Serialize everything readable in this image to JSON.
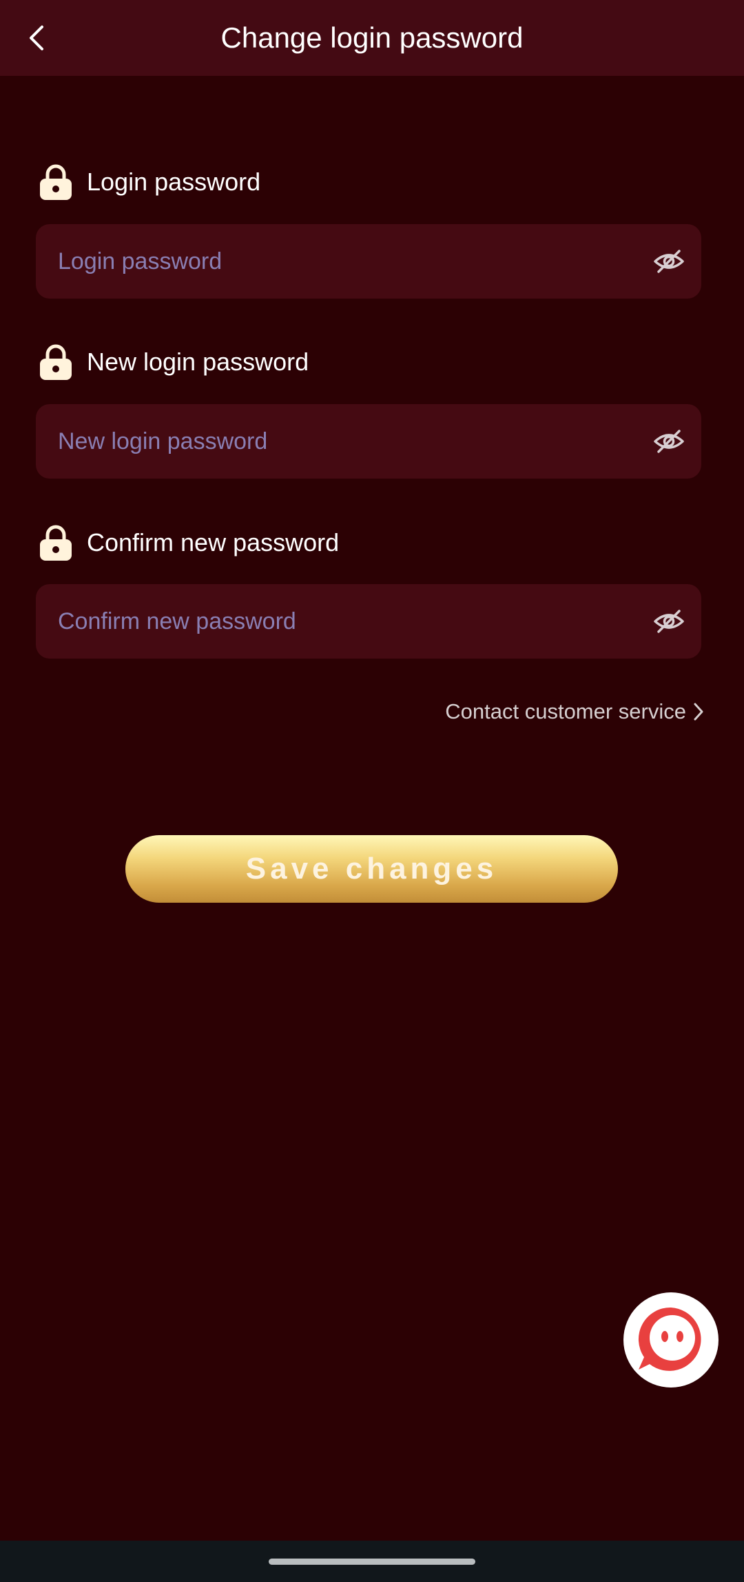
{
  "header": {
    "title": "Change login password"
  },
  "fields": [
    {
      "label": "Login password",
      "placeholder": "Login password"
    },
    {
      "label": "New login password",
      "placeholder": "New login password"
    },
    {
      "label": "Confirm new password",
      "placeholder": "Confirm new password"
    }
  ],
  "contact": {
    "label": "Contact customer service"
  },
  "save": {
    "label": "Save changes"
  },
  "icons": {
    "back": "chevron-left-icon",
    "lock": "lock-icon",
    "eye": "eye-off-icon",
    "chevron": "chevron-right-icon",
    "chat": "chat-icon"
  },
  "colors": {
    "background": "#2c0104",
    "header": "#440a13",
    "input": "#450a12",
    "placeholder": "#8a7fb3",
    "gold_top": "#fff7b8",
    "gold_bottom": "#c28e38",
    "chat_red": "#e8403f"
  }
}
